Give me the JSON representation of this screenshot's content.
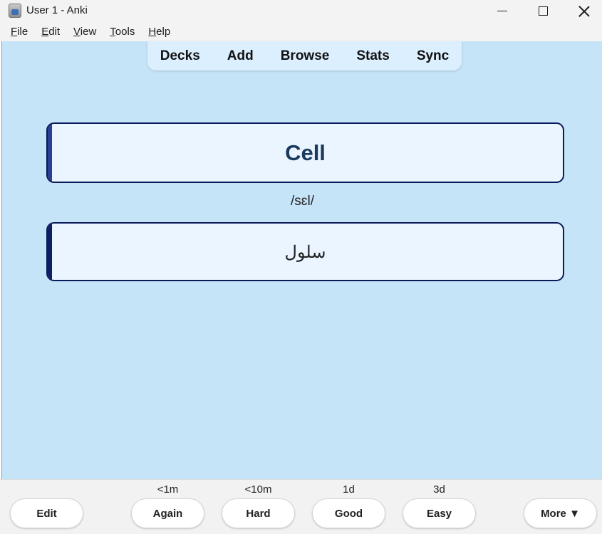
{
  "window": {
    "title": "User 1 - Anki"
  },
  "menubar": {
    "items": [
      {
        "accel": "F",
        "rest": "ile"
      },
      {
        "accel": "E",
        "rest": "dit"
      },
      {
        "accel": "V",
        "rest": "iew"
      },
      {
        "accel": "T",
        "rest": "ools"
      },
      {
        "accel": "H",
        "rest": "elp"
      }
    ]
  },
  "toolbar": {
    "decks": "Decks",
    "add": "Add",
    "browse": "Browse",
    "stats": "Stats",
    "sync": "Sync"
  },
  "card": {
    "word": "Cell",
    "pronunciation": "/sɛl/",
    "translation": "سلول"
  },
  "bottom": {
    "edit": "Edit",
    "more": "More ▼",
    "answers": [
      {
        "label": "Again",
        "interval": "<1m"
      },
      {
        "label": "Hard",
        "interval": "<10m"
      },
      {
        "label": "Good",
        "interval": "1d"
      },
      {
        "label": "Easy",
        "interval": "3d"
      }
    ]
  },
  "colors": {
    "background": "#c5e4f8",
    "card_fill": "#eaf5ff",
    "card_border": "#0a1a5a",
    "word_text": "#1a3a5e"
  }
}
